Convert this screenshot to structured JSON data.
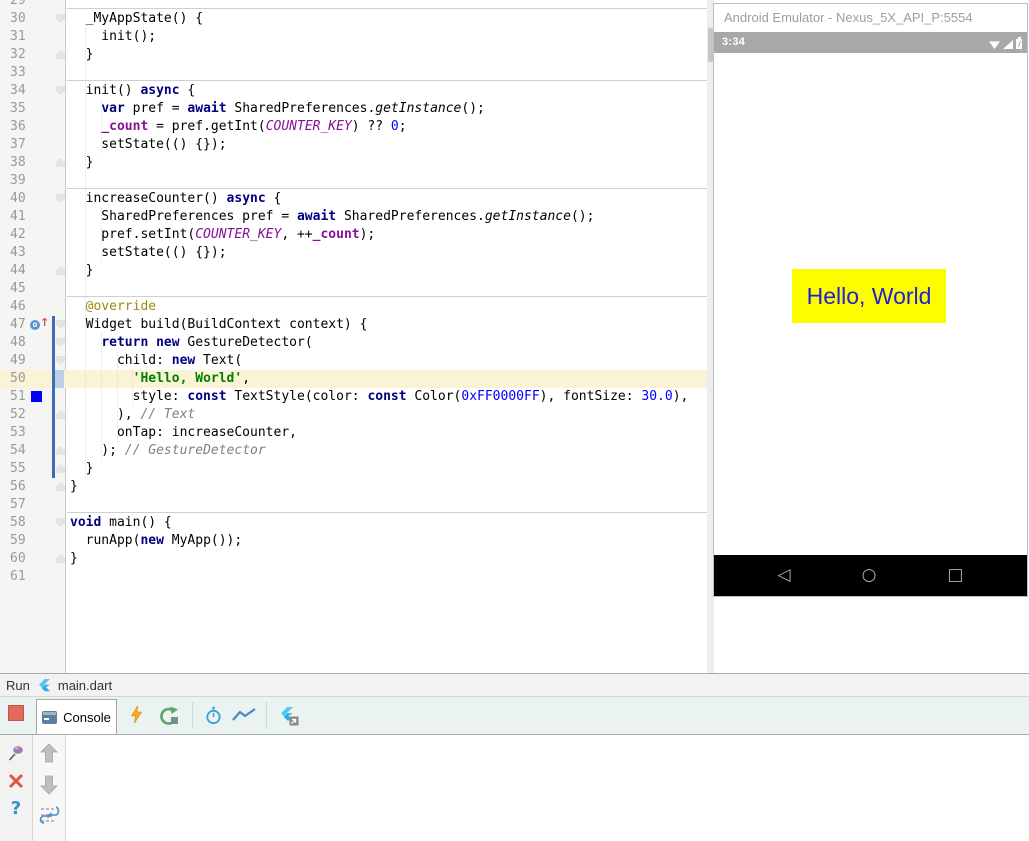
{
  "colors": {
    "keyword": "#000080",
    "string": "#008000",
    "number": "#0000FF",
    "comment": "#808080",
    "field": "#871094",
    "annotation": "#9E880D",
    "vcs": "#3C6EB4",
    "current_line": "#FBF3D6",
    "hello_bg": "#FDFD00",
    "hello_text": "#2222CC",
    "stop": "#E2695B"
  },
  "editor": {
    "current_line": 50,
    "vcs_changed_lines": [
      47,
      55
    ],
    "lines": [
      {
        "n": 29,
        "segs": []
      },
      {
        "n": 30,
        "sep": true,
        "fold": "down",
        "segs": [
          [
            "  _MyAppState() {",
            "p"
          ]
        ]
      },
      {
        "n": 31,
        "segs": [
          [
            "    init();",
            "p"
          ]
        ]
      },
      {
        "n": 32,
        "fold": "up",
        "segs": [
          [
            "  }",
            "p"
          ]
        ]
      },
      {
        "n": 33,
        "segs": []
      },
      {
        "n": 34,
        "sep": true,
        "fold": "down",
        "segs": [
          [
            "  init() ",
            "p"
          ],
          [
            "async",
            "k"
          ],
          [
            " {",
            "p"
          ]
        ]
      },
      {
        "n": 35,
        "segs": [
          [
            "    ",
            "p"
          ],
          [
            "var",
            "k"
          ],
          [
            " pref = ",
            "p"
          ],
          [
            "await",
            "k"
          ],
          [
            " SharedPreferences.",
            "p"
          ],
          [
            "getInstance",
            "m"
          ],
          [
            "();",
            "p"
          ]
        ]
      },
      {
        "n": 36,
        "segs": [
          [
            "    ",
            "p"
          ],
          [
            "_count",
            "f"
          ],
          [
            " = pref.getInt(",
            "p"
          ],
          [
            "COUNTER_KEY",
            "i"
          ],
          [
            ") ?? ",
            "p"
          ],
          [
            "0",
            "n"
          ],
          [
            ";",
            "p"
          ]
        ]
      },
      {
        "n": 37,
        "segs": [
          [
            "    setState(() {});",
            "p"
          ]
        ]
      },
      {
        "n": 38,
        "fold": "up",
        "segs": [
          [
            "  }",
            "p"
          ]
        ]
      },
      {
        "n": 39,
        "segs": []
      },
      {
        "n": 40,
        "sep": true,
        "fold": "down",
        "segs": [
          [
            "  increaseCounter() ",
            "p"
          ],
          [
            "async",
            "k"
          ],
          [
            " {",
            "p"
          ]
        ]
      },
      {
        "n": 41,
        "segs": [
          [
            "    SharedPreferences pref = ",
            "p"
          ],
          [
            "await",
            "k"
          ],
          [
            " SharedPreferences.",
            "p"
          ],
          [
            "getInstance",
            "m"
          ],
          [
            "();",
            "p"
          ]
        ]
      },
      {
        "n": 42,
        "segs": [
          [
            "    pref.setInt(",
            "p"
          ],
          [
            "COUNTER_KEY",
            "i"
          ],
          [
            ", ++",
            "p"
          ],
          [
            "_count",
            "f"
          ],
          [
            ");",
            "p"
          ]
        ]
      },
      {
        "n": 43,
        "segs": [
          [
            "    setState(() {});",
            "p"
          ]
        ]
      },
      {
        "n": 44,
        "fold": "up",
        "segs": [
          [
            "  }",
            "p"
          ]
        ]
      },
      {
        "n": 45,
        "segs": []
      },
      {
        "n": 46,
        "sep": true,
        "segs": [
          [
            "  ",
            "p"
          ],
          [
            "@override",
            "a"
          ]
        ]
      },
      {
        "n": 47,
        "fold": "down",
        "mark": "override",
        "segs": [
          [
            "  Widget build(BuildContext context) {",
            "p"
          ]
        ]
      },
      {
        "n": 48,
        "fold": "down",
        "segs": [
          [
            "    ",
            "p"
          ],
          [
            "return",
            "k"
          ],
          [
            " ",
            "p"
          ],
          [
            "new",
            "k"
          ],
          [
            " GestureDetector(",
            "p"
          ]
        ]
      },
      {
        "n": 49,
        "fold": "down",
        "segs": [
          [
            "      child: ",
            "p"
          ],
          [
            "new",
            "k"
          ],
          [
            " Text(",
            "p"
          ]
        ]
      },
      {
        "n": 50,
        "segs": [
          [
            "        ",
            "p"
          ],
          [
            "'Hello, World'",
            "s"
          ],
          [
            ",",
            "p"
          ]
        ]
      },
      {
        "n": 51,
        "mark": "swatch",
        "segs": [
          [
            "        style: ",
            "p"
          ],
          [
            "const",
            "k"
          ],
          [
            " TextStyle(color: ",
            "p"
          ],
          [
            "const",
            "k"
          ],
          [
            " Color(",
            "p"
          ],
          [
            "0xFF0000FF",
            "n"
          ],
          [
            "), fontSize: ",
            "p"
          ],
          [
            "30.0",
            "n"
          ],
          [
            "),",
            "p"
          ]
        ]
      },
      {
        "n": 52,
        "fold": "up",
        "segs": [
          [
            "      ), ",
            "p"
          ],
          [
            "// Text",
            "c"
          ]
        ]
      },
      {
        "n": 53,
        "segs": [
          [
            "      onTap: increaseCounter,",
            "p"
          ]
        ]
      },
      {
        "n": 54,
        "fold": "up",
        "segs": [
          [
            "    ); ",
            "p"
          ],
          [
            "// GestureDetector",
            "c"
          ]
        ]
      },
      {
        "n": 55,
        "fold": "up",
        "segs": [
          [
            "  }",
            "p"
          ]
        ]
      },
      {
        "n": 56,
        "fold": "up",
        "segs": [
          [
            "}",
            "p"
          ]
        ]
      },
      {
        "n": 57,
        "segs": []
      },
      {
        "n": 58,
        "sep": true,
        "fold": "down",
        "segs": [
          [
            "void",
            "k"
          ],
          [
            " main() {",
            "p"
          ]
        ]
      },
      {
        "n": 59,
        "segs": [
          [
            "  runApp(",
            "p"
          ],
          [
            "new",
            "k"
          ],
          [
            " MyApp());",
            "p"
          ]
        ]
      },
      {
        "n": 60,
        "fold": "up",
        "segs": [
          [
            "}",
            "p"
          ]
        ]
      },
      {
        "n": 61,
        "segs": []
      }
    ]
  },
  "emulator": {
    "title": "Android Emulator - Nexus_5X_API_P:5554",
    "status_time": "3:34",
    "app_text": "Hello, World",
    "nav": {
      "back": "◁",
      "home": "○",
      "recents": "□"
    }
  },
  "run_panel": {
    "run_label": "Run",
    "file_name": "main.dart",
    "console_tab": "Console",
    "help_glyph": "?",
    "toolbar_icons": [
      "hot-reload",
      "restart",
      "timer",
      "performance",
      "open-devtools"
    ],
    "side_icons": [
      "pin",
      "close",
      "help"
    ],
    "scroll_icons": [
      "up",
      "down",
      "soft-wrap"
    ]
  }
}
